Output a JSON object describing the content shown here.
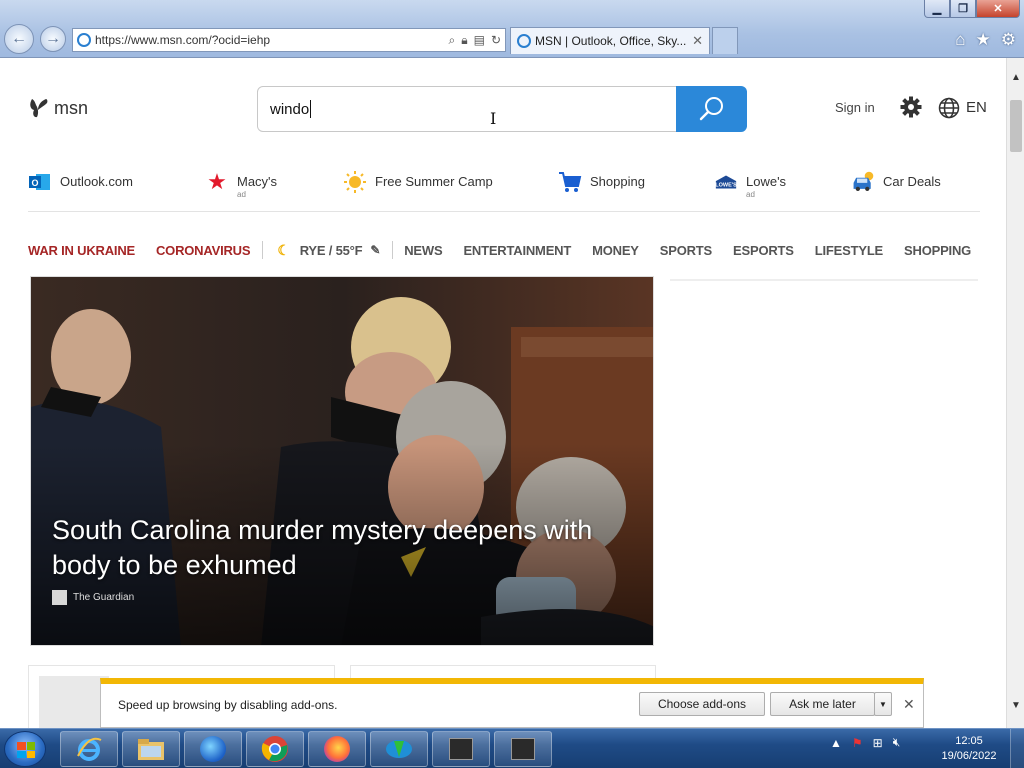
{
  "browser": {
    "url": "https://www.msn.com/?ocid=iehp",
    "tab_title": "MSN | Outlook, Office, Sky...",
    "window_controls": [
      "minimize",
      "restore",
      "close"
    ],
    "toolbar_icons": [
      "home-icon",
      "favorites-star-icon",
      "tools-gear-icon"
    ]
  },
  "header": {
    "logo_text": "msn",
    "search_value": "windo",
    "sign_in_label": "Sign in",
    "language_label": "EN",
    "search_button_color": "#2b88d9"
  },
  "quicklinks": [
    {
      "label": "Outlook.com",
      "ad": "",
      "icon": "outlook-icon"
    },
    {
      "label": "Macy's",
      "ad": "ad",
      "icon": "macys-star-icon"
    },
    {
      "label": "Free Summer Camp",
      "ad": "",
      "icon": "sun-icon"
    },
    {
      "label": "Shopping",
      "ad": "",
      "icon": "shopping-cart-icon"
    },
    {
      "label": "Lowe's",
      "ad": "ad",
      "icon": "lowes-icon"
    },
    {
      "label": "Car Deals",
      "ad": "",
      "icon": "car-icon"
    }
  ],
  "navbar": {
    "war": "WAR IN UKRAINE",
    "corona": "CORONAVIRUS",
    "weather": "RYE / 55°F",
    "news": "NEWS",
    "entertainment": "ENTERTAINMENT",
    "money": "MONEY",
    "sports": "SPORTS",
    "esports": "ESPORTS",
    "lifestyle": "LIFESTYLE",
    "shopping": "SHOPPING",
    "accent_color": "#a52626"
  },
  "hero": {
    "title": "South Carolina murder mystery deepens with body to be exhumed",
    "source": "The Guardian"
  },
  "notification": {
    "text": "Speed up browsing by disabling add-ons.",
    "choose_label": "Choose add-ons",
    "later_label": "Ask me later",
    "accent_color": "#f2b705"
  },
  "taskbar": {
    "apps": [
      "internet-explorer-icon",
      "file-explorer-icon",
      "firefox-dev-icon",
      "chrome-icon",
      "firefox-icon",
      "download-manager-icon",
      "app-icon-1",
      "app-icon-2"
    ],
    "time": "12:05",
    "date": "19/06/2022"
  }
}
